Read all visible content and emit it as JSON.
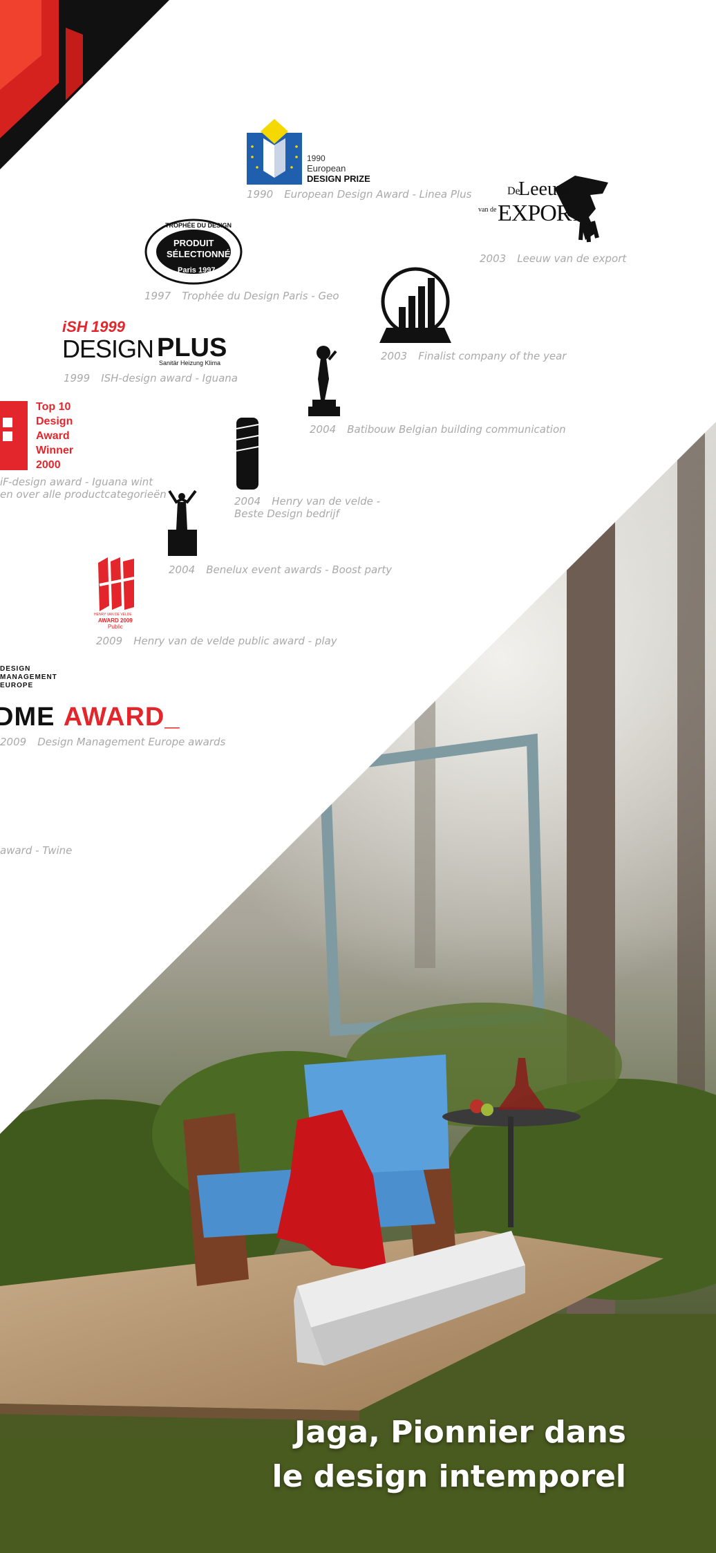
{
  "awards": [
    {
      "year": "1990",
      "label": "European Design Award - Linea Plus"
    },
    {
      "year": "2003",
      "label": "Leeuw van de export"
    },
    {
      "year": "1997",
      "label": "Trophée du Design Paris - Geo"
    },
    {
      "year": "2003",
      "label": "Finalist company of the year"
    },
    {
      "year": "1999",
      "label": "ISH-design award - Iguana"
    },
    {
      "year": "2004",
      "label": "Batibouw Belgian building communication"
    },
    {
      "label_line1": "iF-design award - Iguana wint",
      "label_line2": "en over alle productcategorieën"
    },
    {
      "year": "2004",
      "label_line1": "Henry van de velde -",
      "label_line2": "Beste Design bedrijf"
    },
    {
      "year": "2004",
      "label": "Benelux event awards - Boost party"
    },
    {
      "year": "2009",
      "label": "Henry van de velde public award - play"
    },
    {
      "year": "2009",
      "label": "Design Management Europe awards"
    },
    {
      "label": "award - Twine"
    }
  ],
  "logos": {
    "edp": {
      "year": "1990",
      "line1": "European",
      "line2": "DESIGN PRIZE"
    },
    "leeuw": {
      "text1": "De",
      "text2": "Leeuw",
      "text3": "van de",
      "text4": "EXPORT"
    },
    "trophee": {
      "ring": "TROPHÉE DU DESIGN",
      "line1": "PRODUIT",
      "line2": "SÉLECTIONNÉ",
      "bottom": "Paris 1997"
    },
    "ish": {
      "brand": "iSH",
      "year": "1999",
      "design": "DESIGN",
      "plus": "PLUS",
      "sub": "Sanitär Heizung Klima"
    },
    "if": {
      "line1": "Top 10",
      "line2": "Design",
      "line3": "Award",
      "line4": "Winner",
      "line5": "2000"
    },
    "hvdv": {
      "line1": "HENRY VAN DE VELDE",
      "line2": "AWARD 2009",
      "line3": "Public"
    },
    "dme": {
      "line1": "DESIGN",
      "line2": "MANAGEMENT",
      "line3": "EUROPE",
      "dme": "DME",
      "award": "AWARD_"
    }
  },
  "headline": {
    "line1": "Jaga, Pionnier dans",
    "line2": "le design intemporel"
  },
  "colors": {
    "caption": "#a9a9a9",
    "red": "#e3262b",
    "blue": "#1f5fae"
  }
}
